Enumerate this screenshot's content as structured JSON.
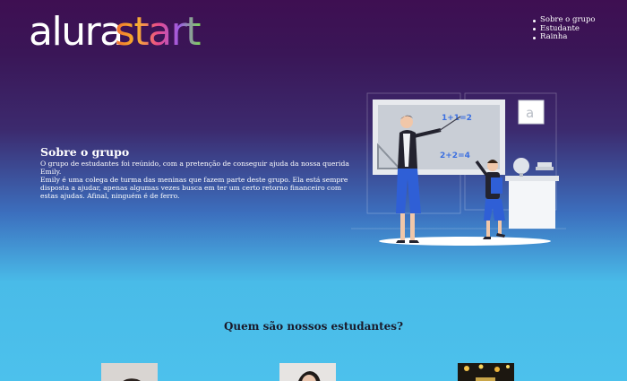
{
  "header": {
    "logo": {
      "part1": "alura",
      "part2": "start"
    },
    "nav": [
      {
        "label": "Sobre o grupo"
      },
      {
        "label": "Estudante"
      },
      {
        "label": "Rainha"
      }
    ]
  },
  "about": {
    "title": "Sobre o grupo",
    "paragraph1": "O grupo de estudantes foi reúnido, com a pretenção de conseguir ajuda da nossa querida Emily.",
    "paragraph2": "Emily é uma colega de turma das meninas que fazem parte deste grupo. Ela está sempre disposta a ajudar, apenas algumas vezes busca em ter um certo retorno financeiro com estas ajudas. Afinal, ninguém é de ferro."
  },
  "illustration": {
    "board1": "1+1=2",
    "board2": "2+2=4",
    "frame_letter": "a"
  },
  "students": {
    "title": "Quem são nossos estudantes?"
  },
  "colors": {
    "bg_top": "#3e0f52",
    "bg_bottom": "#4cc1ec",
    "accent_blue": "#2f5fd6"
  }
}
